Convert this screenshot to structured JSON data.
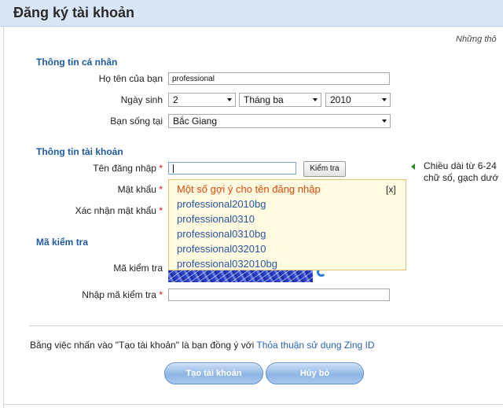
{
  "header": {
    "title": "Đăng ký tài khoản"
  },
  "top_note": "Những thô",
  "personal": {
    "section_title": "Thông tin cá nhân",
    "fullname_label": "Họ tên của bạn",
    "fullname_value": "professional",
    "dob_label": "Ngày sinh",
    "day_value": "2",
    "month_value": "Tháng ba",
    "year_value": "2010",
    "city_label": "Bạn sống tại",
    "city_value": "Bắc Giang"
  },
  "account": {
    "section_title": "Thông tin tài khoản",
    "username_label": "Tên đăng nhập",
    "username_value": "",
    "check_button": "Kiểm tra",
    "password_label": "Mật khẩu",
    "confirm_label": "Xác nhận mật khẩu",
    "required_mark": "*",
    "hint_line1": "Chiều dài từ 6-24",
    "hint_line2": "chữ số, gạch dướ"
  },
  "suggestions": {
    "title": "Một số gợi ý cho tên đăng nhập",
    "close": "[x]",
    "items": [
      "professional2010bg",
      "professional0310",
      "professional0310bg",
      "professional032010",
      "professional032010bg"
    ]
  },
  "captcha": {
    "section_title": "Mã kiểm tra",
    "image_label": "Mã kiểm tra",
    "input_label": "Nhập mã kiểm tra",
    "input_value": ""
  },
  "footer": {
    "agree_text": "Bằng việc nhấn vào \"Tạo tài khoản\" là bạn đồng ý với",
    "agree_link": "Thỏa thuận sử dụng Zing ID",
    "create_button": "Tạo tài khoản",
    "cancel_button": "Hủy bỏ"
  },
  "colors": {
    "header_bg": "#d9e6f6",
    "section_title": "#1e5a9e",
    "required": "#cc1111",
    "suggest_bg": "#fffbe0",
    "suggest_title": "#e3480c",
    "link": "#2a63b8",
    "button": "#8fb5e5"
  },
  "icons": {
    "captcha_refresh": "refresh-icon",
    "hint_pointer": "arrow-left-icon",
    "select_caret": "chevron-down-icon"
  }
}
